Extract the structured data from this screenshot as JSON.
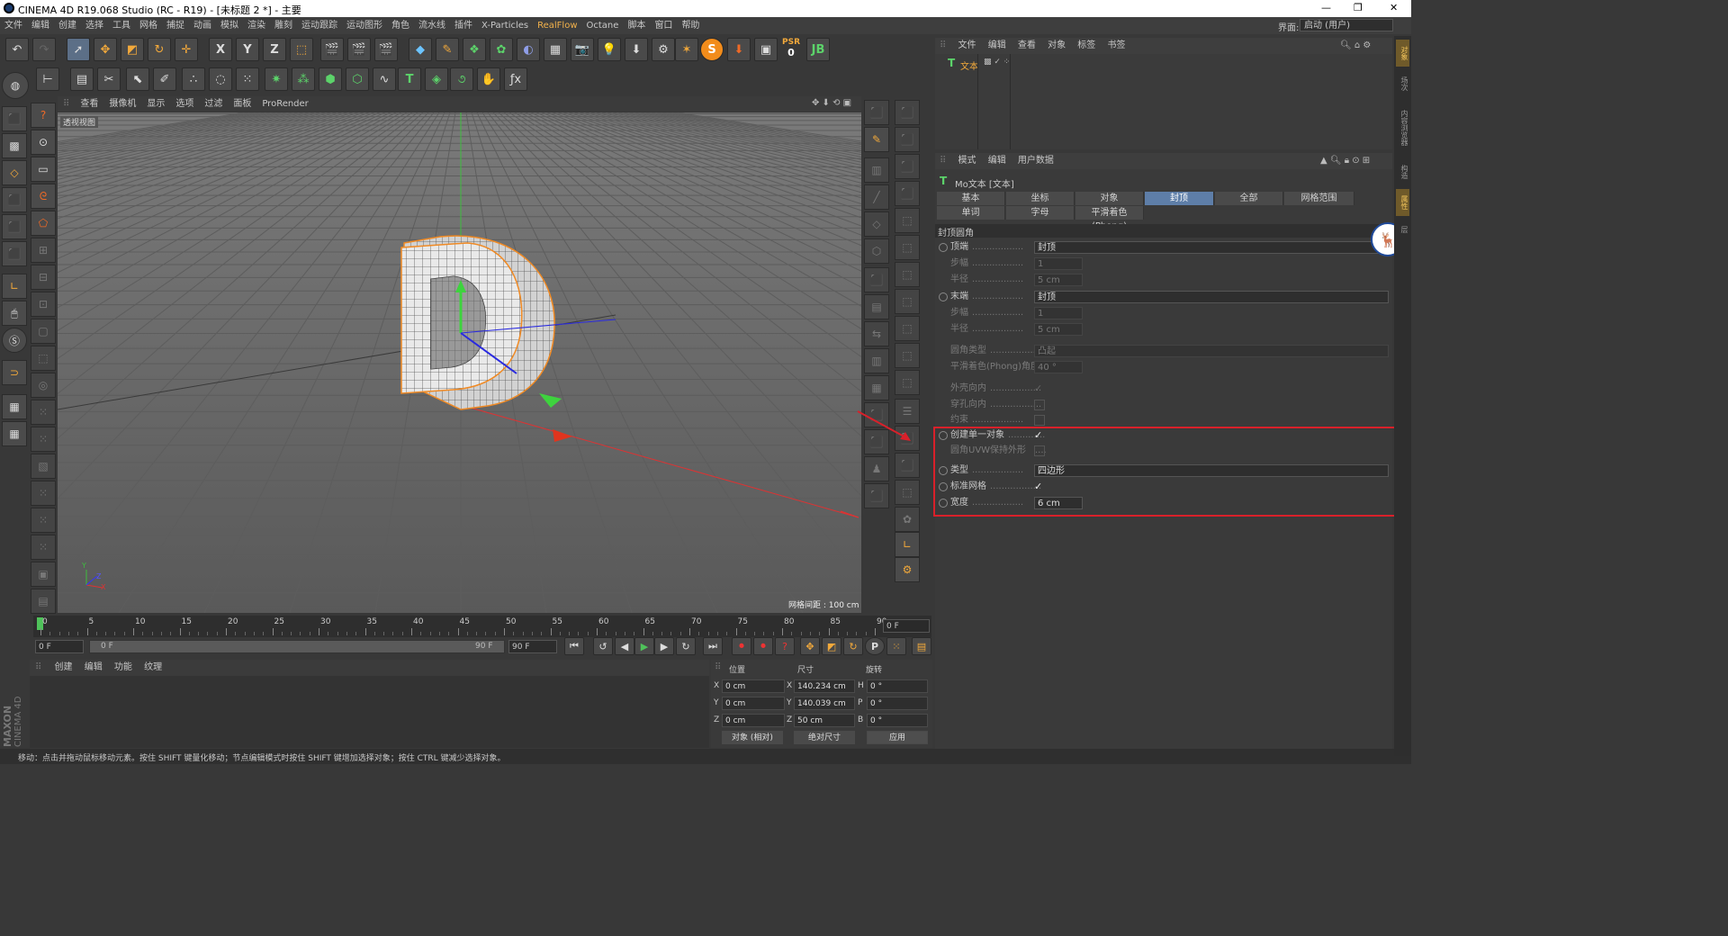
{
  "titlebar": {
    "title": "CINEMA 4D R19.068 Studio (RC - R19) - [未标题 2 *] - 主要",
    "min": "—",
    "max": "❐",
    "close": "✕"
  },
  "menu": [
    "文件",
    "编辑",
    "创建",
    "选择",
    "工具",
    "网格",
    "捕捉",
    "动画",
    "模拟",
    "渲染",
    "雕刻",
    "运动跟踪",
    "运动图形",
    "角色",
    "流水线",
    "插件",
    "X-Particles",
    "RealFlow",
    "Octane",
    "脚本",
    "窗口",
    "帮助"
  ],
  "layout": {
    "label": "界面:",
    "value": "启动 (用户)"
  },
  "toolbar": {
    "x": "X",
    "y": "Y",
    "z": "Z",
    "psr": "PSR",
    "psr_num": "0"
  },
  "viewport": {
    "menu": [
      "查看",
      "摄像机",
      "显示",
      "选项",
      "过滤",
      "面板",
      "ProRender"
    ],
    "label": "透视视图",
    "grid_info": "网格间距 : 100 cm",
    "object_letter": "D",
    "axis_y": "Y",
    "axis_z": "Z",
    "axis_x": "X"
  },
  "timeline": {
    "ticks": [
      "0",
      "5",
      "10",
      "15",
      "20",
      "25",
      "30",
      "35",
      "40",
      "45",
      "50",
      "55",
      "60",
      "65",
      "70",
      "75",
      "80",
      "85",
      "90"
    ],
    "frame_display": "0 F"
  },
  "transport": {
    "start": "0 F",
    "range_start": "0 F",
    "range_end": "90 F",
    "end": "90 F",
    "p_label": "P"
  },
  "material_menu": [
    "创建",
    "编辑",
    "功能",
    "纹理"
  ],
  "coords": {
    "headers": {
      "position": "位置",
      "size": "尺寸",
      "rotation": "旋转"
    },
    "rows": [
      {
        "axis": "X",
        "pos": "0 cm",
        "size_axis": "X",
        "size": "140.234 cm",
        "rot_axis": "H",
        "rot": "0 °"
      },
      {
        "axis": "Y",
        "pos": "0 cm",
        "size_axis": "Y",
        "size": "140.039 cm",
        "rot_axis": "P",
        "rot": "0 °"
      },
      {
        "axis": "Z",
        "pos": "0 cm",
        "size_axis": "Z",
        "size": "50 cm",
        "rot_axis": "B",
        "rot": "0 °"
      }
    ],
    "mode1": "对象 (相对)",
    "mode2": "绝对尺寸",
    "apply": "应用"
  },
  "maxon": {
    "line1": "MAXON",
    "line2": "CINEMA 4D"
  },
  "status": "移动：点击并拖动鼠标移动元素。按住 SHIFT 键量化移动；节点编辑模式时按住 SHIFT 键增加选择对象；按住 CTRL 键减少选择对象。",
  "object_manager": {
    "menu": [
      "文件",
      "编辑",
      "查看",
      "对象",
      "标签",
      "书签"
    ],
    "object_name": "文本"
  },
  "attributes": {
    "menu": [
      "模式",
      "编辑",
      "用户数据"
    ],
    "title": "Mo文本 [文本]",
    "tabs_row1": [
      "基本",
      "坐标",
      "对象",
      "封顶",
      "全部",
      "网格范围"
    ],
    "tabs_row2": [
      "单词",
      "字母",
      "平滑着色(Phong)"
    ],
    "active_tab": "封顶",
    "section": "封顶圆角",
    "rows": [
      {
        "label": "顶端",
        "type": "dropdown",
        "value": "封顶",
        "dim": false,
        "radio": true
      },
      {
        "label": "步幅",
        "type": "field",
        "value": "1",
        "dim": true,
        "radio": false
      },
      {
        "label": "半径",
        "type": "field",
        "value": "5 cm",
        "dim": true,
        "radio": false
      },
      {
        "label": "末端",
        "type": "dropdown",
        "value": "封顶",
        "dim": false,
        "radio": true
      },
      {
        "label": "步幅",
        "type": "field",
        "value": "1",
        "dim": true,
        "radio": false
      },
      {
        "label": "半径",
        "type": "field",
        "value": "5 cm",
        "dim": true,
        "radio": false
      },
      {
        "label": "圆角类型",
        "type": "dropdown",
        "value": "凸起",
        "dim": true,
        "radio": false
      },
      {
        "label": "平滑着色(Phong)角度",
        "type": "field",
        "value": "40 °",
        "dim": true,
        "radio": false
      },
      {
        "label": "外壳向内",
        "type": "check",
        "value": "✓",
        "dim": true,
        "radio": false
      },
      {
        "label": "穿孔向内",
        "type": "check",
        "value": "",
        "dim": true,
        "radio": false
      },
      {
        "label": "约束",
        "type": "check",
        "value": "",
        "dim": true,
        "radio": false
      },
      {
        "label": "创建单一对象",
        "type": "check",
        "value": "✓",
        "dim": false,
        "radio": true
      },
      {
        "label": "圆角UVW保持外形",
        "type": "check",
        "value": "",
        "dim": true,
        "radio": false
      },
      {
        "label": "类型",
        "type": "dropdown",
        "value": "四边形",
        "dim": false,
        "radio": true
      },
      {
        "label": "标准网格",
        "type": "check",
        "value": "✓",
        "dim": false,
        "radio": true
      },
      {
        "label": "宽度",
        "type": "field",
        "value": "6 cm",
        "dim": false,
        "radio": true
      }
    ]
  },
  "side_tabs": [
    "对象",
    "场次",
    "内容浏览器",
    "构造",
    "属性",
    "层"
  ],
  "colors": {
    "accent": "#5e7ea8",
    "highlight_box": "#d9202a",
    "selection": "#f08a24"
  }
}
